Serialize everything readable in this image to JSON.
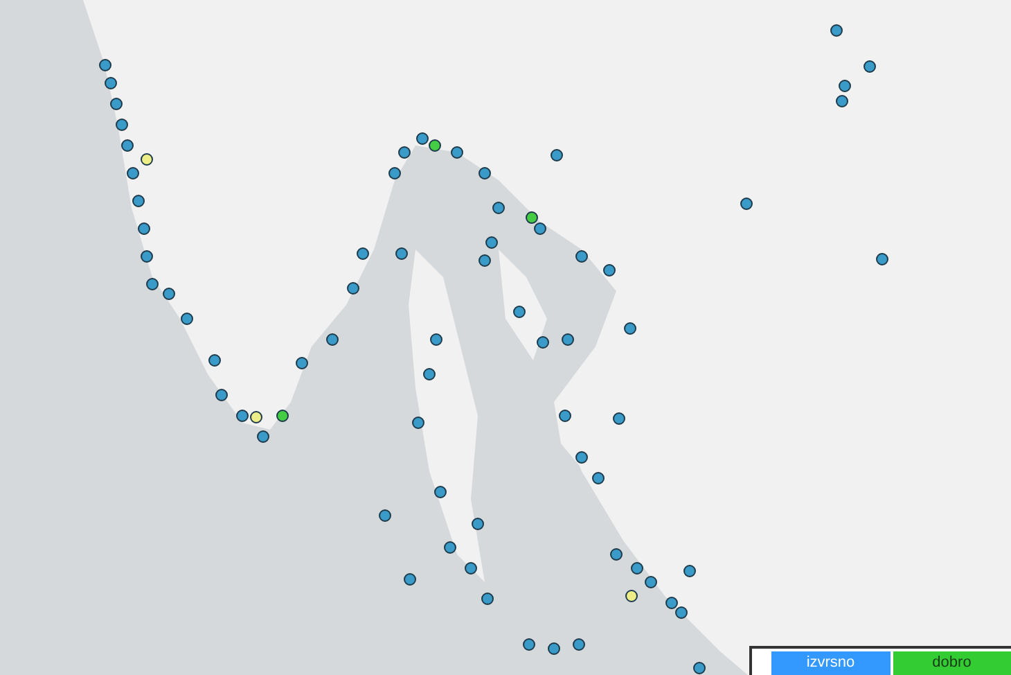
{
  "legend": {
    "items": [
      {
        "label": "izvrsno",
        "color": "#3399ff"
      },
      {
        "label": "dobro",
        "color": "#33cc33"
      }
    ]
  }
}
